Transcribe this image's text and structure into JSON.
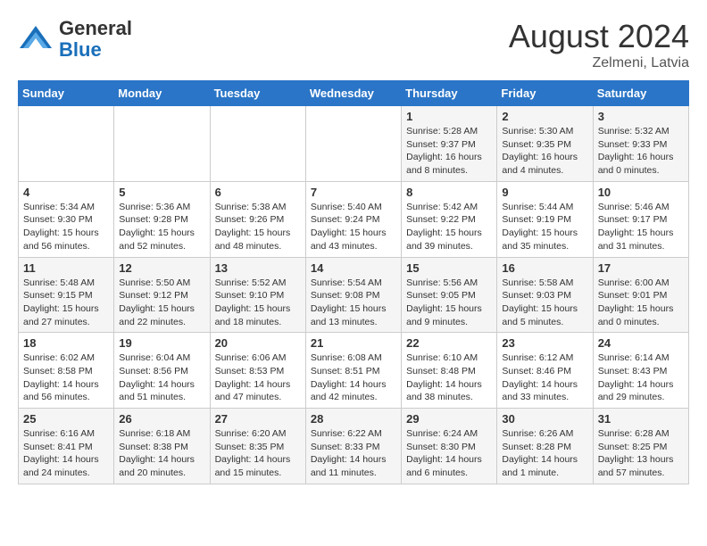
{
  "logo": {
    "general": "General",
    "blue": "Blue"
  },
  "title": {
    "month_year": "August 2024",
    "location": "Zelmeni, Latvia"
  },
  "days_of_week": [
    "Sunday",
    "Monday",
    "Tuesday",
    "Wednesday",
    "Thursday",
    "Friday",
    "Saturday"
  ],
  "weeks": [
    [
      {
        "day": "",
        "info": ""
      },
      {
        "day": "",
        "info": ""
      },
      {
        "day": "",
        "info": ""
      },
      {
        "day": "",
        "info": ""
      },
      {
        "day": "1",
        "info": "Sunrise: 5:28 AM\nSunset: 9:37 PM\nDaylight: 16 hours\nand 8 minutes."
      },
      {
        "day": "2",
        "info": "Sunrise: 5:30 AM\nSunset: 9:35 PM\nDaylight: 16 hours\nand 4 minutes."
      },
      {
        "day": "3",
        "info": "Sunrise: 5:32 AM\nSunset: 9:33 PM\nDaylight: 16 hours\nand 0 minutes."
      }
    ],
    [
      {
        "day": "4",
        "info": "Sunrise: 5:34 AM\nSunset: 9:30 PM\nDaylight: 15 hours\nand 56 minutes."
      },
      {
        "day": "5",
        "info": "Sunrise: 5:36 AM\nSunset: 9:28 PM\nDaylight: 15 hours\nand 52 minutes."
      },
      {
        "day": "6",
        "info": "Sunrise: 5:38 AM\nSunset: 9:26 PM\nDaylight: 15 hours\nand 48 minutes."
      },
      {
        "day": "7",
        "info": "Sunrise: 5:40 AM\nSunset: 9:24 PM\nDaylight: 15 hours\nand 43 minutes."
      },
      {
        "day": "8",
        "info": "Sunrise: 5:42 AM\nSunset: 9:22 PM\nDaylight: 15 hours\nand 39 minutes."
      },
      {
        "day": "9",
        "info": "Sunrise: 5:44 AM\nSunset: 9:19 PM\nDaylight: 15 hours\nand 35 minutes."
      },
      {
        "day": "10",
        "info": "Sunrise: 5:46 AM\nSunset: 9:17 PM\nDaylight: 15 hours\nand 31 minutes."
      }
    ],
    [
      {
        "day": "11",
        "info": "Sunrise: 5:48 AM\nSunset: 9:15 PM\nDaylight: 15 hours\nand 27 minutes."
      },
      {
        "day": "12",
        "info": "Sunrise: 5:50 AM\nSunset: 9:12 PM\nDaylight: 15 hours\nand 22 minutes."
      },
      {
        "day": "13",
        "info": "Sunrise: 5:52 AM\nSunset: 9:10 PM\nDaylight: 15 hours\nand 18 minutes."
      },
      {
        "day": "14",
        "info": "Sunrise: 5:54 AM\nSunset: 9:08 PM\nDaylight: 15 hours\nand 13 minutes."
      },
      {
        "day": "15",
        "info": "Sunrise: 5:56 AM\nSunset: 9:05 PM\nDaylight: 15 hours\nand 9 minutes."
      },
      {
        "day": "16",
        "info": "Sunrise: 5:58 AM\nSunset: 9:03 PM\nDaylight: 15 hours\nand 5 minutes."
      },
      {
        "day": "17",
        "info": "Sunrise: 6:00 AM\nSunset: 9:01 PM\nDaylight: 15 hours\nand 0 minutes."
      }
    ],
    [
      {
        "day": "18",
        "info": "Sunrise: 6:02 AM\nSunset: 8:58 PM\nDaylight: 14 hours\nand 56 minutes."
      },
      {
        "day": "19",
        "info": "Sunrise: 6:04 AM\nSunset: 8:56 PM\nDaylight: 14 hours\nand 51 minutes."
      },
      {
        "day": "20",
        "info": "Sunrise: 6:06 AM\nSunset: 8:53 PM\nDaylight: 14 hours\nand 47 minutes."
      },
      {
        "day": "21",
        "info": "Sunrise: 6:08 AM\nSunset: 8:51 PM\nDaylight: 14 hours\nand 42 minutes."
      },
      {
        "day": "22",
        "info": "Sunrise: 6:10 AM\nSunset: 8:48 PM\nDaylight: 14 hours\nand 38 minutes."
      },
      {
        "day": "23",
        "info": "Sunrise: 6:12 AM\nSunset: 8:46 PM\nDaylight: 14 hours\nand 33 minutes."
      },
      {
        "day": "24",
        "info": "Sunrise: 6:14 AM\nSunset: 8:43 PM\nDaylight: 14 hours\nand 29 minutes."
      }
    ],
    [
      {
        "day": "25",
        "info": "Sunrise: 6:16 AM\nSunset: 8:41 PM\nDaylight: 14 hours\nand 24 minutes."
      },
      {
        "day": "26",
        "info": "Sunrise: 6:18 AM\nSunset: 8:38 PM\nDaylight: 14 hours\nand 20 minutes."
      },
      {
        "day": "27",
        "info": "Sunrise: 6:20 AM\nSunset: 8:35 PM\nDaylight: 14 hours\nand 15 minutes."
      },
      {
        "day": "28",
        "info": "Sunrise: 6:22 AM\nSunset: 8:33 PM\nDaylight: 14 hours\nand 11 minutes."
      },
      {
        "day": "29",
        "info": "Sunrise: 6:24 AM\nSunset: 8:30 PM\nDaylight: 14 hours\nand 6 minutes."
      },
      {
        "day": "30",
        "info": "Sunrise: 6:26 AM\nSunset: 8:28 PM\nDaylight: 14 hours\nand 1 minute."
      },
      {
        "day": "31",
        "info": "Sunrise: 6:28 AM\nSunset: 8:25 PM\nDaylight: 13 hours\nand 57 minutes."
      }
    ]
  ]
}
